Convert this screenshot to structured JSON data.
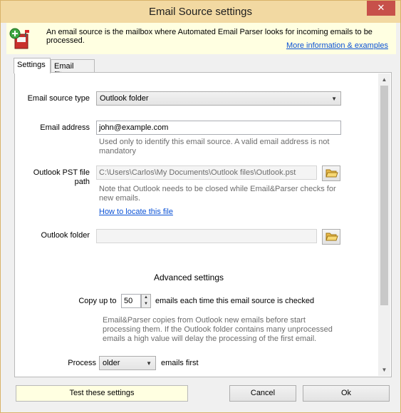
{
  "window": {
    "title": "Email Source settings",
    "close_glyph": "✕"
  },
  "banner": {
    "icon": "mailbox-add-icon",
    "text": "An email source is the mailbox where Automated Email Parser looks for incoming emails to be processed.",
    "link": "More information & examples"
  },
  "tabs": [
    {
      "label": "Settings",
      "active": true
    },
    {
      "label": "Email filters",
      "active": false
    }
  ],
  "form": {
    "source_type_label": "Email source type",
    "source_type_value": "Outlook folder",
    "email_label": "Email address",
    "email_value": "john@example.com",
    "email_note": "Used only to identify this email source. A valid email address is not mandatory",
    "pst_label": "Outlook PST file path",
    "pst_value": "C:\\Users\\Carlos\\My Documents\\Outlook files\\Outlook.pst",
    "pst_note": "Note that Outlook needs to be closed while Email&Parser checks for new emails.",
    "pst_link": "How to locate this file",
    "folder_label": "Outlook folder",
    "folder_value": "",
    "advanced_heading": "Advanced settings",
    "copy_label": "Copy",
    "copy_prefix": "up to",
    "copy_value": "50",
    "copy_suffix": "emails each time this email source is checked",
    "copy_note": "Email&Parser copies from Outlook new emails before start processing them. If the Outlook folder contains many unprocessed emails a high value will delay the processing of the first email.",
    "process_label": "Process",
    "process_value": "older",
    "process_suffix": "emails first"
  },
  "buttons": {
    "test": "Test these settings",
    "cancel": "Cancel",
    "ok": "Ok"
  },
  "colors": {
    "titlebar": "#f2d9a2",
    "banner": "#ffffe1",
    "link": "#0b52d6",
    "close": "#c7504a"
  }
}
